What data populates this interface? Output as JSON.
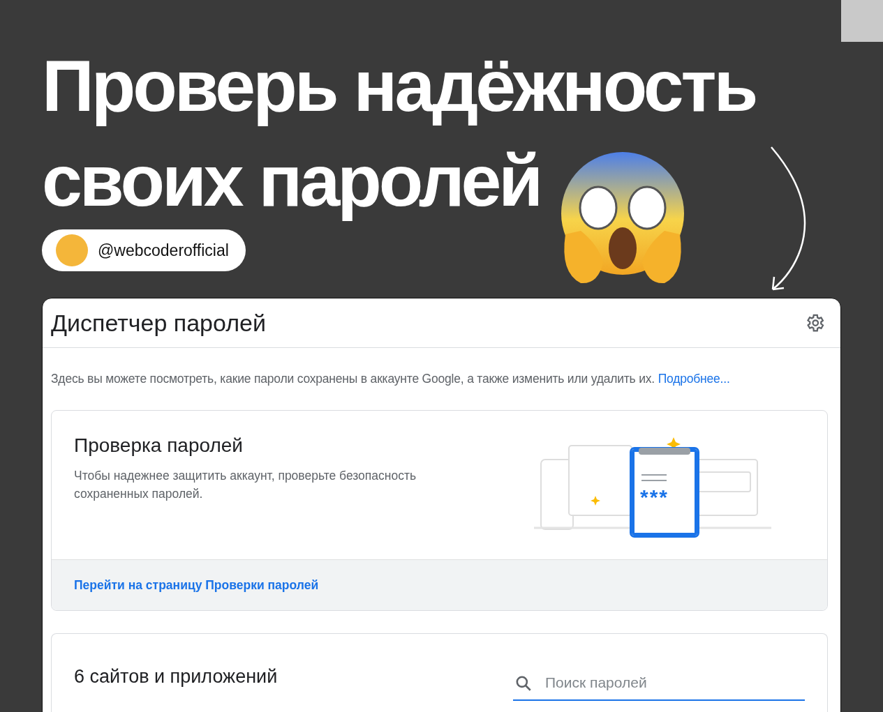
{
  "post": {
    "title_lines": [
      "Проверь надёжность",
      "своих паролей"
    ],
    "handle": "@webcoderofficial"
  },
  "manager": {
    "title": "Диспетчер паролей",
    "description": "Здесь вы можете посмотреть, какие пароли сохранены в аккаунте Google, а также изменить или удалить их.",
    "link": "Подробнее...",
    "check": {
      "title": "Проверка паролей",
      "text": "Чтобы надежнее защитить аккаунт, проверьте безопасность сохраненных паролей.",
      "illustration_text": "***",
      "action": "Перейти на страницу Проверки паролей"
    },
    "list": {
      "count": "6 сайтов и приложений",
      "search": {
        "placeholder": "Поиск паролей"
      }
    }
  }
}
